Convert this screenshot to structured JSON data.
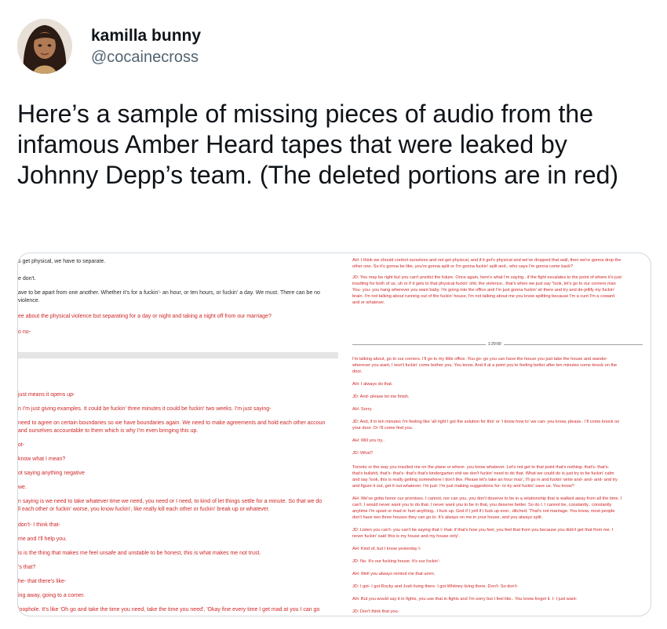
{
  "author": {
    "name": "kamilla bunny",
    "handle": "@cocainecross",
    "avatar_icon": "avatar-illustration-icon"
  },
  "tweet": {
    "text": "Here’s a sample of missing pieces of audio from the infamous Amber Heard tapes that were leaked by Johnny Depp’s team. (The deleted portions are in red)"
  },
  "left_transcript": [
    {
      "text": "s get physical, we have to separate.",
      "color": "black"
    },
    {
      "text": "e don't.",
      "color": "black"
    },
    {
      "text": "ave to be apart from one another. Whether it's for a fuckin'- an hour, or ten hours, or fuckin' a day. We must. There can be no",
      "color": "black"
    },
    {
      "text": "violence.",
      "color": "black"
    },
    {
      "text": "ee about the physical violence but separating for a day or night and taking a night off from our marriage?",
      "color": "red"
    },
    {
      "text": "o no-",
      "color": "red"
    },
    {
      "text": "just means it opens up-",
      "color": "red"
    },
    {
      "text": "n I'm just giving examples. It could be fuckin' three minutes it could be fuckin' two weeks. I'm just saying-",
      "color": "red"
    },
    {
      "text": "need to agree on certain boundaries so we have boundaries again. We need to make agreements and hold each other accoun",
      "color": "red"
    },
    {
      "text": "and ourselves accountable to them which is why I'm even bringing this up.",
      "color": "red"
    },
    {
      "text": "ot-",
      "color": "red"
    },
    {
      "text": "know what I mean?",
      "color": "red"
    },
    {
      "text": "ot saying anything negative",
      "color": "red"
    },
    {
      "text": "we.",
      "color": "red"
    },
    {
      "text": "n saying is we need to take whatever time we need, you need or I need, to kind of let things settle for a minute. So that we do",
      "color": "red"
    },
    {
      "text": "ll each other or fuckin' worse, you know fuckin', like really kill each other or fuckin' break up or whatever.",
      "color": "red"
    },
    {
      "text": "don't- I think that-",
      "color": "red"
    },
    {
      "text": "me and I'll help you.",
      "color": "red"
    },
    {
      "text": "is is the thing that makes me feel unsafe and unstable to be honest, this is what makes me not trust.",
      "color": "red"
    },
    {
      "text": "'s that?",
      "color": "red"
    },
    {
      "text": "he- that there's like-",
      "color": "red"
    },
    {
      "text": "ing away, going to a corner.",
      "color": "red"
    },
    {
      "text": "loophole. It's like 'Oh go and take the time you need, take the time you need', 'Okay fine every time I get mad at you I can go",
      "color": "red"
    },
    {
      "text": "'oh wait, I don't have my own place to go to split to.'",
      "color": "red"
    }
  ],
  "right_transcript": [
    {
      "text": "AH: I think we should control ourselves and not get physical, and if it get's physical and we've dropped that wall, then we're gonna drop the",
      "color": "red"
    },
    {
      "text": "other one. So it's gonna be like, you're gonna split or I'm gonna fuckin' split and.. who says I'm gonna come back?",
      "color": "red"
    },
    {
      "text": "JD: You may be right but you can't predict the future. Once again, here's what I'm saying.. if the fight escalates to the point of where it's just",
      "color": "red"
    },
    {
      "text": "insulting for both of us, uh or if it gets to that physical fuckin' shit, the violence.. that's when we just say \"look, let's go to our corners man",
      "color": "red"
    },
    {
      "text": "You- you- you hang wherever you want baby. I'm going into the office and I'm just gonna fuckin' sit there and try and de-jellify my fuckin'",
      "color": "red"
    },
    {
      "text": "brain. I'm not talking about running out of the fuckin' house, I'm not talking about me you know splitting because I'm a cunt I'm a coward",
      "color": "red"
    },
    {
      "text": "and or whatever.",
      "color": "red"
    },
    {
      "text": "I'm talking about, go to our corners. I'll go to my little office. You go- go you can have the house you just take the house and wander",
      "color": "red"
    },
    {
      "text": "wherever you want, I won't fuckin' come bother you. You know. And if at a point you're feeling better after ten minutes come knock on the",
      "color": "red"
    },
    {
      "text": "door.",
      "color": "red"
    },
    {
      "text": "AH: I always do that.",
      "color": "red"
    },
    {
      "text": "JD: And- please let me finish.",
      "color": "red"
    },
    {
      "text": "AH: Sorry.",
      "color": "red"
    },
    {
      "text": "JD: And, if in ten minutes I'm feeling like 'all right I got the solution for this' or 'I know how to' we can- you know, please.. I'll come knock on",
      "color": "red"
    },
    {
      "text": "your door. Or I'll come find you.",
      "color": "red"
    },
    {
      "text": "AH: Will you try..",
      "color": "red"
    },
    {
      "text": "JD: What?",
      "color": "red"
    },
    {
      "text": "Toronto or the way you insulted me on the plane or where- you know whatever. Let's not get to that point that's nothing- that's- that's-",
      "color": "red"
    },
    {
      "text": "that's bullshit, that's- that's- that's that's kindergarten shit we don't fuckin' need to do that. What we could do is just try to be fuckin' calm",
      "color": "red"
    },
    {
      "text": "and say 'look, this is really getting somewhere I don't like. Please let's take an hour max', I'll go in and fuckin' write and- and- and- and try",
      "color": "red"
    },
    {
      "text": "and figure it out, get it out whatever. I'm just- I'm just making suggestions for- to try and fuckin' save us. You know?",
      "color": "red"
    },
    {
      "text": "AH: We've gotta honor our promises. I cannot, nor can you, you don't deserve to be in a relationship that is walked away from all the time. I",
      "color": "red"
    },
    {
      "text": "can't. I would never want you to do that. I never want you to be in that, you deserve better. So do I. I cannot be, constantly.. constantly",
      "color": "red"
    },
    {
      "text": "anytime I'm upset or mad or hurt anything.. I fuck up. God if I yell if I fuck up ever.. ditched. 'That's not marriage. You know, most people",
      "color": "red"
    },
    {
      "text": "don't have two three houses they can go to. It's always on me in your house, and you always split.",
      "color": "red"
    },
    {
      "text": "JD: Listen you can't- you can't be saying that I- that- if that's how you feel, you feel that from you because you didn't get that from me. I",
      "color": "red"
    },
    {
      "text": "never fuckin' said 'this is my house and my house only'.",
      "color": "red"
    },
    {
      "text": "AH: Kind of, but I know yesterday I-",
      "color": "red"
    },
    {
      "text": "JD: No. It's our fucking house. It's our fuckin'-",
      "color": "red"
    },
    {
      "text": "AH: Well you always remind me that umm.",
      "color": "red"
    },
    {
      "text": "JD: I got- I got Rocky and Josh living there. I got Whitney living there. Don't- So don't-",
      "color": "red"
    },
    {
      "text": "AH: But you would say it in fights, you use that in fights and I'm sorry but I feel like.. You know forget it. I- I just want-",
      "color": "red"
    },
    {
      "text": "JD: Don't think that you-",
      "color": "red"
    },
    {
      "text": "AH: I just want the security and the commitment from you that we have destroyed, both of us. And I don't know if that matters to you, but",
      "color": "red"
    },
    {
      "text": "personally like if you need that.",
      "color": "red"
    },
    {
      "text": "JD: It absolutely matters to me.",
      "color": "red"
    }
  ],
  "divider_label": "1:20:00",
  "colors": {
    "text_primary": "#0f1419",
    "text_secondary": "#536471",
    "transcript_red": "#cf2626",
    "transcript_black": "#2a2a2a",
    "border": "#cfd9de"
  }
}
